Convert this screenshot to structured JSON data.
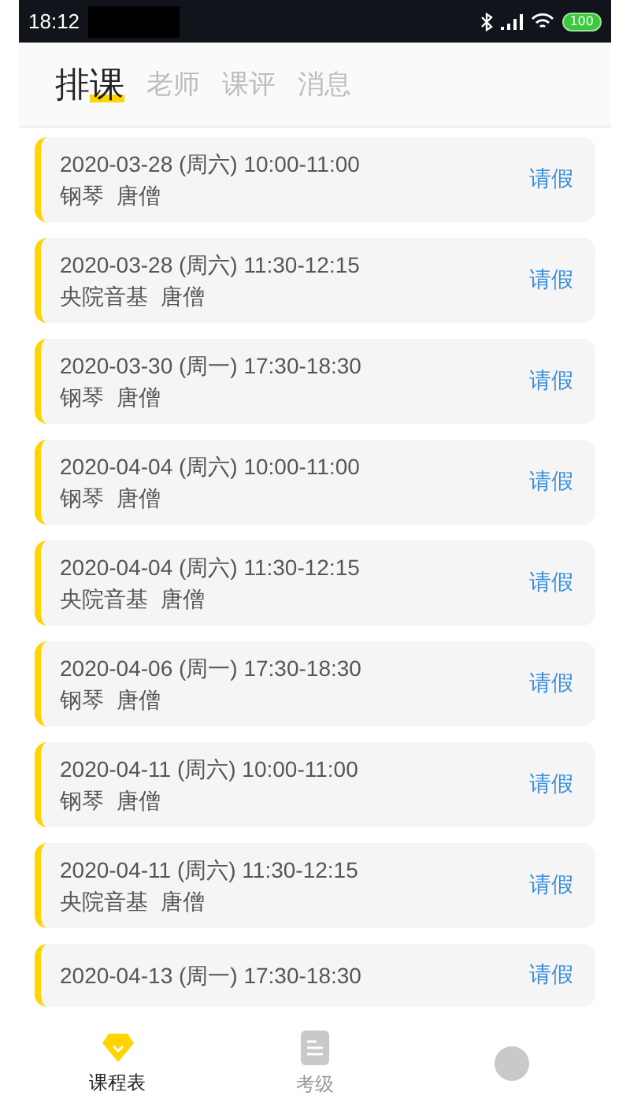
{
  "status_bar": {
    "time": "18:12",
    "battery": "100"
  },
  "tabs": [
    {
      "label": "排课",
      "selected": true
    },
    {
      "label": "老师",
      "selected": false
    },
    {
      "label": "课评",
      "selected": false
    },
    {
      "label": "消息",
      "selected": false
    }
  ],
  "lessons": [
    {
      "datetime": "2020-03-28 (周六) 10:00-11:00",
      "detail": "钢琴  唐僧",
      "action": "请假"
    },
    {
      "datetime": "2020-03-28 (周六) 11:30-12:15",
      "detail": "央院音基  唐僧",
      "action": "请假"
    },
    {
      "datetime": "2020-03-30 (周一) 17:30-18:30",
      "detail": "钢琴  唐僧",
      "action": "请假"
    },
    {
      "datetime": "2020-04-04 (周六) 10:00-11:00",
      "detail": "钢琴  唐僧",
      "action": "请假"
    },
    {
      "datetime": "2020-04-04 (周六) 11:30-12:15",
      "detail": "央院音基  唐僧",
      "action": "请假"
    },
    {
      "datetime": "2020-04-06 (周一) 17:30-18:30",
      "detail": "钢琴  唐僧",
      "action": "请假"
    },
    {
      "datetime": "2020-04-11 (周六) 10:00-11:00",
      "detail": "钢琴  唐僧",
      "action": "请假"
    },
    {
      "datetime": "2020-04-11 (周六) 11:30-12:15",
      "detail": "央院音基  唐僧",
      "action": "请假"
    },
    {
      "datetime": "2020-04-13 (周一) 17:30-18:30",
      "action": "请假"
    }
  ],
  "bottom_nav": [
    {
      "kind": "schedule",
      "label": "课程表",
      "selected": true
    },
    {
      "kind": "exam",
      "label": "考级",
      "selected": false
    },
    {
      "kind": "profile",
      "selected": false
    }
  ]
}
